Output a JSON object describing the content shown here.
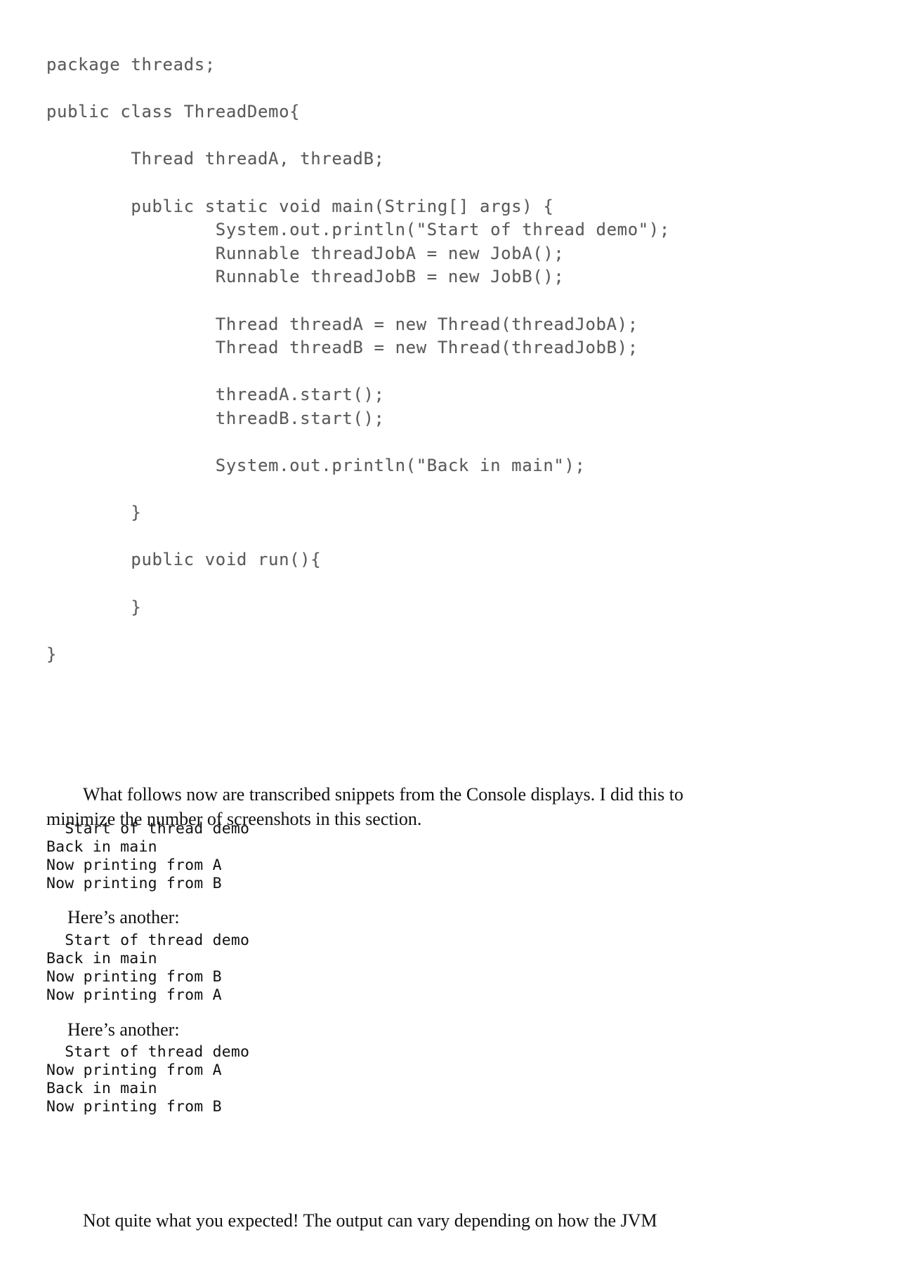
{
  "document": {
    "type": "book-page",
    "background_color": "#ffffff",
    "code_text_color": "#5a5a5c",
    "body_text_color": "#111111"
  },
  "code_listing": {
    "language": "java",
    "lines": [
      "package threads;",
      "",
      "public class ThreadDemo{",
      "",
      "        Thread threadA, threadB;",
      "",
      "        public static void main(String[] args) {",
      "                System.out.println(\"Start of thread demo\");",
      "                Runnable threadJobA = new JobA();",
      "                Runnable threadJobB = new JobB();",
      "",
      "                Thread threadA = new Thread(threadJobA);",
      "                Thread threadB = new Thread(threadJobB);",
      "",
      "                threadA.start();",
      "                threadB.start();",
      "",
      "                System.out.println(\"Back in main\");",
      "",
      "        }",
      "",
      "        public void run(){",
      "",
      "        }",
      "",
      "}"
    ]
  },
  "paragraphs": {
    "intro": "What follows now are transcribed snippets from the Console displays. I did this to minimize the number of screenshots in this section.",
    "closing": "Not quite what you expected! The output can vary depending on how the JVM"
  },
  "hints": {
    "another_1": "Here’s another:",
    "another_2": "Here’s another:"
  },
  "console_outputs": [
    {
      "id": "console-1",
      "lines": [
        "  Start of thread demo",
        "Back in main",
        "Now printing from A",
        "Now printing from B"
      ]
    },
    {
      "id": "console-2",
      "lines": [
        "  Start of thread demo",
        "Back in main",
        "Now printing from B",
        "Now printing from A"
      ]
    },
    {
      "id": "console-3",
      "lines": [
        "  Start of thread demo",
        "Now printing from A",
        "Back in main",
        "Now printing from B"
      ]
    }
  ]
}
